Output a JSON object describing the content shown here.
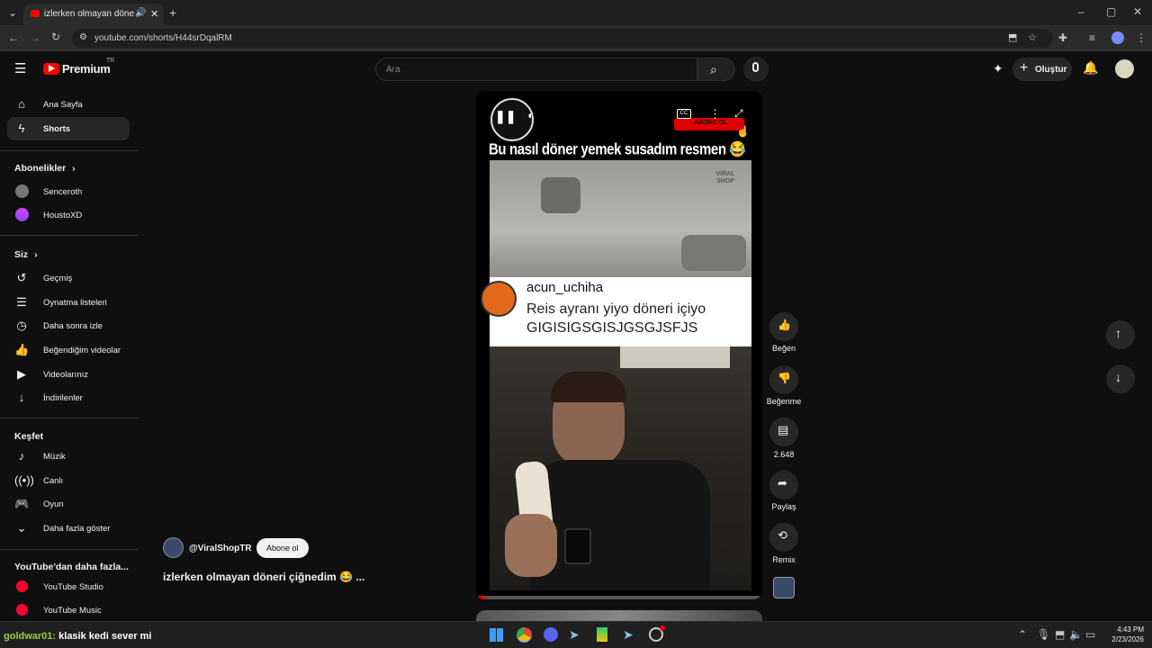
{
  "browser": {
    "tab_title": "izlerken olmayan döneri çiğ",
    "url": "youtube.com/shorts/H44srDqalRM",
    "window_controls": [
      "minimize-icon",
      "restore-icon",
      "close-icon"
    ]
  },
  "header": {
    "logo_text": "Premium",
    "logo_badge": "TR",
    "search_placeholder": "Ara",
    "create_label": "Oluştur"
  },
  "sidebar": {
    "main": [
      {
        "label": "Ana Sayfa",
        "icon": "home-icon"
      },
      {
        "label": "Shorts",
        "icon": "shorts-icon",
        "active": true
      }
    ],
    "subscriptions_title": "Abonelikler",
    "subscriptions": [
      {
        "label": "Senceroth"
      },
      {
        "label": "HoustoXD"
      }
    ],
    "you_title": "Siz",
    "you": [
      {
        "label": "Geçmiş",
        "icon": "history-icon"
      },
      {
        "label": "Oynatma listeleri",
        "icon": "playlist-icon"
      },
      {
        "label": "Daha sonra izle",
        "icon": "clock-icon"
      },
      {
        "label": "Beğendiğim videolar",
        "icon": "thumb-up-icon"
      },
      {
        "label": "Videolarınız",
        "icon": "video-icon"
      },
      {
        "label": "İndirilenler",
        "icon": "download-icon"
      }
    ],
    "explore_title": "Keşfet",
    "explore": [
      {
        "label": "Müzik",
        "icon": "music-icon"
      },
      {
        "label": "Canlı",
        "icon": "live-icon"
      },
      {
        "label": "Oyun",
        "icon": "gamepad-icon"
      },
      {
        "label": "Daha fazla göster",
        "icon": "chevron-down-icon"
      }
    ],
    "more_title": "YouTube'dan daha fazla...",
    "more": [
      {
        "label": "YouTube Studio"
      },
      {
        "label": "YouTube Music"
      }
    ]
  },
  "video": {
    "caption": "Bu nasıl döner yemek susadım resmen 😂",
    "watermark": "VIRAL SHOP",
    "comment_user": "acun_uchiha",
    "comment_text_1": "Reis ayranı yiyo döneri içiyo",
    "comment_text_2": "GIGISIGSGISJGSGJSFJS",
    "overlay_subscribe": "ABONE OL",
    "progress": 0.03
  },
  "channel": {
    "handle": "@ViralShopTR",
    "subscribe_label": "Abone ol",
    "title": "izlerken olmayan döneri çiğnedim 😂 ..."
  },
  "actions": [
    {
      "label": "Beğen",
      "icon": "thumb-up-icon"
    },
    {
      "label": "Beğenme",
      "icon": "thumb-down-icon"
    },
    {
      "label": "2.648",
      "icon": "comment-icon"
    },
    {
      "label": "Paylaş",
      "icon": "share-icon"
    },
    {
      "label": "Remix",
      "icon": "remix-icon"
    }
  ],
  "chat_overlay": {
    "user": "goldwar01:",
    "message": "klasik kedi sever mi"
  },
  "taskbar": {
    "time": "4:43 PM",
    "date": "2/23/2026"
  }
}
